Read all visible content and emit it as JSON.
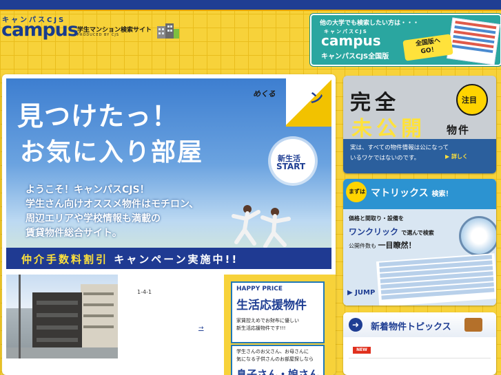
{
  "header": {
    "logo_kana": "キャンパスCJS",
    "logo_main": "campus",
    "tagline": "学生マンション検索サイト",
    "produced_by": "PRODUCED BY CJS"
  },
  "promo": {
    "question": "他の大学でも検索したい方は・・・",
    "kana": "キャンパスCJS",
    "main": "campus",
    "sub": "キャンパスCJS全国版",
    "go_line1": "全国版へ",
    "go_line2": "GO！"
  },
  "hero": {
    "title_line1": "見つけたっ！",
    "title_line2": "お気に入り部屋",
    "mekuru": "めくる",
    "curl_char": "ン",
    "badge_line1": "新生活",
    "badge_line2": "START",
    "lines": [
      "ようこそ！キャンパスCJS！",
      "学生さん向けオススメ物件はモチロン、",
      "周辺エリアや学校情報も満載の",
      "賃貸物件総合サイト。"
    ],
    "campaign_part1": "仲介手数料割引",
    "campaign_part2": "キャンペーン実施中!!"
  },
  "listing": {
    "address": "1-4-1",
    "arrow_link": "→"
  },
  "happy_price": {
    "title": "HAPPY PRICE",
    "big": "生活応援物件",
    "desc_line1": "家賃控えめでお財布に優しい",
    "desc_line2": "新生活応援物件です!!!",
    "card2_line1": "学生さんのお父さん、お母さんに",
    "card2_line2": "気になる子供さんのお部屋探しなら",
    "card2_big": "息子さん・娘さん"
  },
  "kokai": {
    "kan": "完全",
    "mi": "未公開",
    "bukken": "物件",
    "badge": "注目",
    "desc_line1": "実は、すべての物件情報は公になって",
    "desc_line2": "いるワケではないのです。",
    "link": "▶ 詳しく"
  },
  "matrix": {
    "mazuha": "まずは",
    "title": "マトリックス",
    "title_suffix": "検索！",
    "line1": "価格と間取り・設備を",
    "line2": "ワンクリック",
    "line2_suffix": "で選んで検索",
    "line3": "公開件数も",
    "line3_bold": "一目瞭然！",
    "jump": "JUMP"
  },
  "topics": {
    "title": "新着物件トピックス",
    "new_badge": "NEW"
  }
}
